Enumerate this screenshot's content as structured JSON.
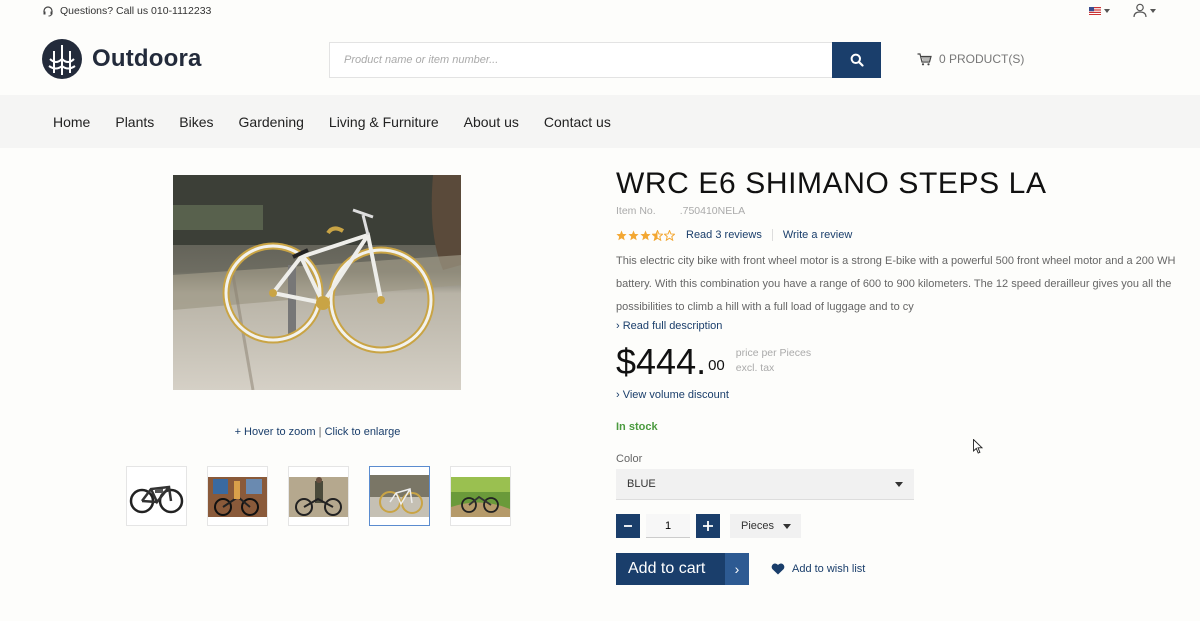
{
  "topbar": {
    "help_text": "Questions? Call us 010-1112233",
    "help_icon": "headset-icon",
    "flag_icon": "us-flag-icon",
    "user_icon": "user-icon"
  },
  "header": {
    "logo_text": "Outdoora",
    "search_placeholder": "Product name or item number...",
    "cart_text": "0 PRODUCT(S)"
  },
  "nav": {
    "items": [
      "Home",
      "Plants",
      "Bikes",
      "Gardening",
      "Living & Furniture",
      "About us",
      "Contact us"
    ]
  },
  "gallery": {
    "zoom_hint_a": "+ Hover to zoom",
    "zoom_hint_sep": "|",
    "zoom_hint_b": "Click to enlarge",
    "active_thumb": 4,
    "thumb_count": 5
  },
  "product": {
    "title": "WRC E6 SHIMANO STEPS LA",
    "item_no_label": "Item No.",
    "item_no": ".750410NELA",
    "rating": 3.5,
    "rating_max": 5,
    "read_reviews": "Read 3 reviews",
    "write_review": "Write a review",
    "description": "This electric city bike with front wheel motor is a strong E-bike with a powerful 500 front wheel motor and a 200 WH battery. With this combination you have a range of 600 to 900 kilometers. The 12 speed derailleur gives you all the possibilities to climb a hill with a full load of luggage and to cy",
    "read_full": "› Read full description",
    "price_main": "$444.",
    "price_cents": "00",
    "price_per": "price per Pieces",
    "price_tax": "excl. tax",
    "volume_discount": "› View volume discount",
    "stock": "In stock",
    "color_label": "Color",
    "color_value": "BLUE",
    "quantity": "1",
    "unit": "Pieces",
    "add_to_cart": "Add to cart",
    "wish_list": "Add to wish list"
  },
  "colors": {
    "primary": "#1a3e6b",
    "star": "#f3a732",
    "stock": "#4a9a3e"
  }
}
